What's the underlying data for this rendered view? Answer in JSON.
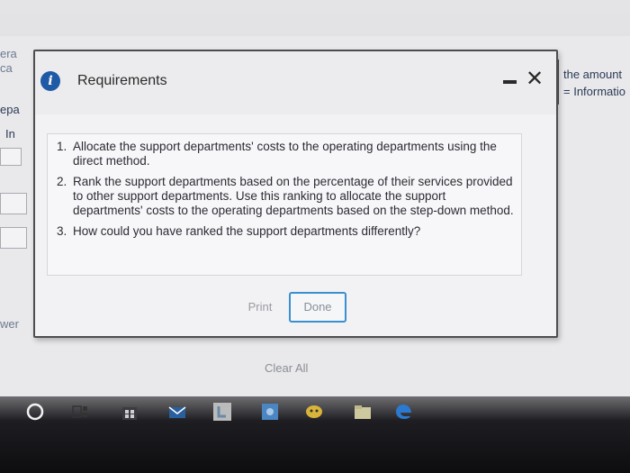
{
  "background": {
    "fragments": [
      "era",
      "ca",
      "epa",
      "In",
      "wer"
    ],
    "right_text": [
      "the amount",
      "= Informatio"
    ],
    "clear_all_label": "Clear All"
  },
  "dialog": {
    "title": "Requirements",
    "info_icon": "info-icon",
    "requirements": [
      {
        "num": "1.",
        "text": "Allocate the support departments' costs to the operating departments using the direct method."
      },
      {
        "num": "2.",
        "text": "Rank the support departments based on the percentage of their services provided to other support departments. Use this ranking to allocate the support departments' costs to the operating departments based on the step-down method."
      },
      {
        "num": "3.",
        "text": "How could you have ranked the support departments differently?"
      }
    ],
    "print_label": "Print",
    "done_label": "Done"
  },
  "taskbar": {
    "icons": [
      "search-circle-icon",
      "task-view-icon",
      "store-icon",
      "mail-icon",
      "launcher-l-icon",
      "photo-icon",
      "messenger-icon",
      "files-icon",
      "edge-icon"
    ]
  }
}
